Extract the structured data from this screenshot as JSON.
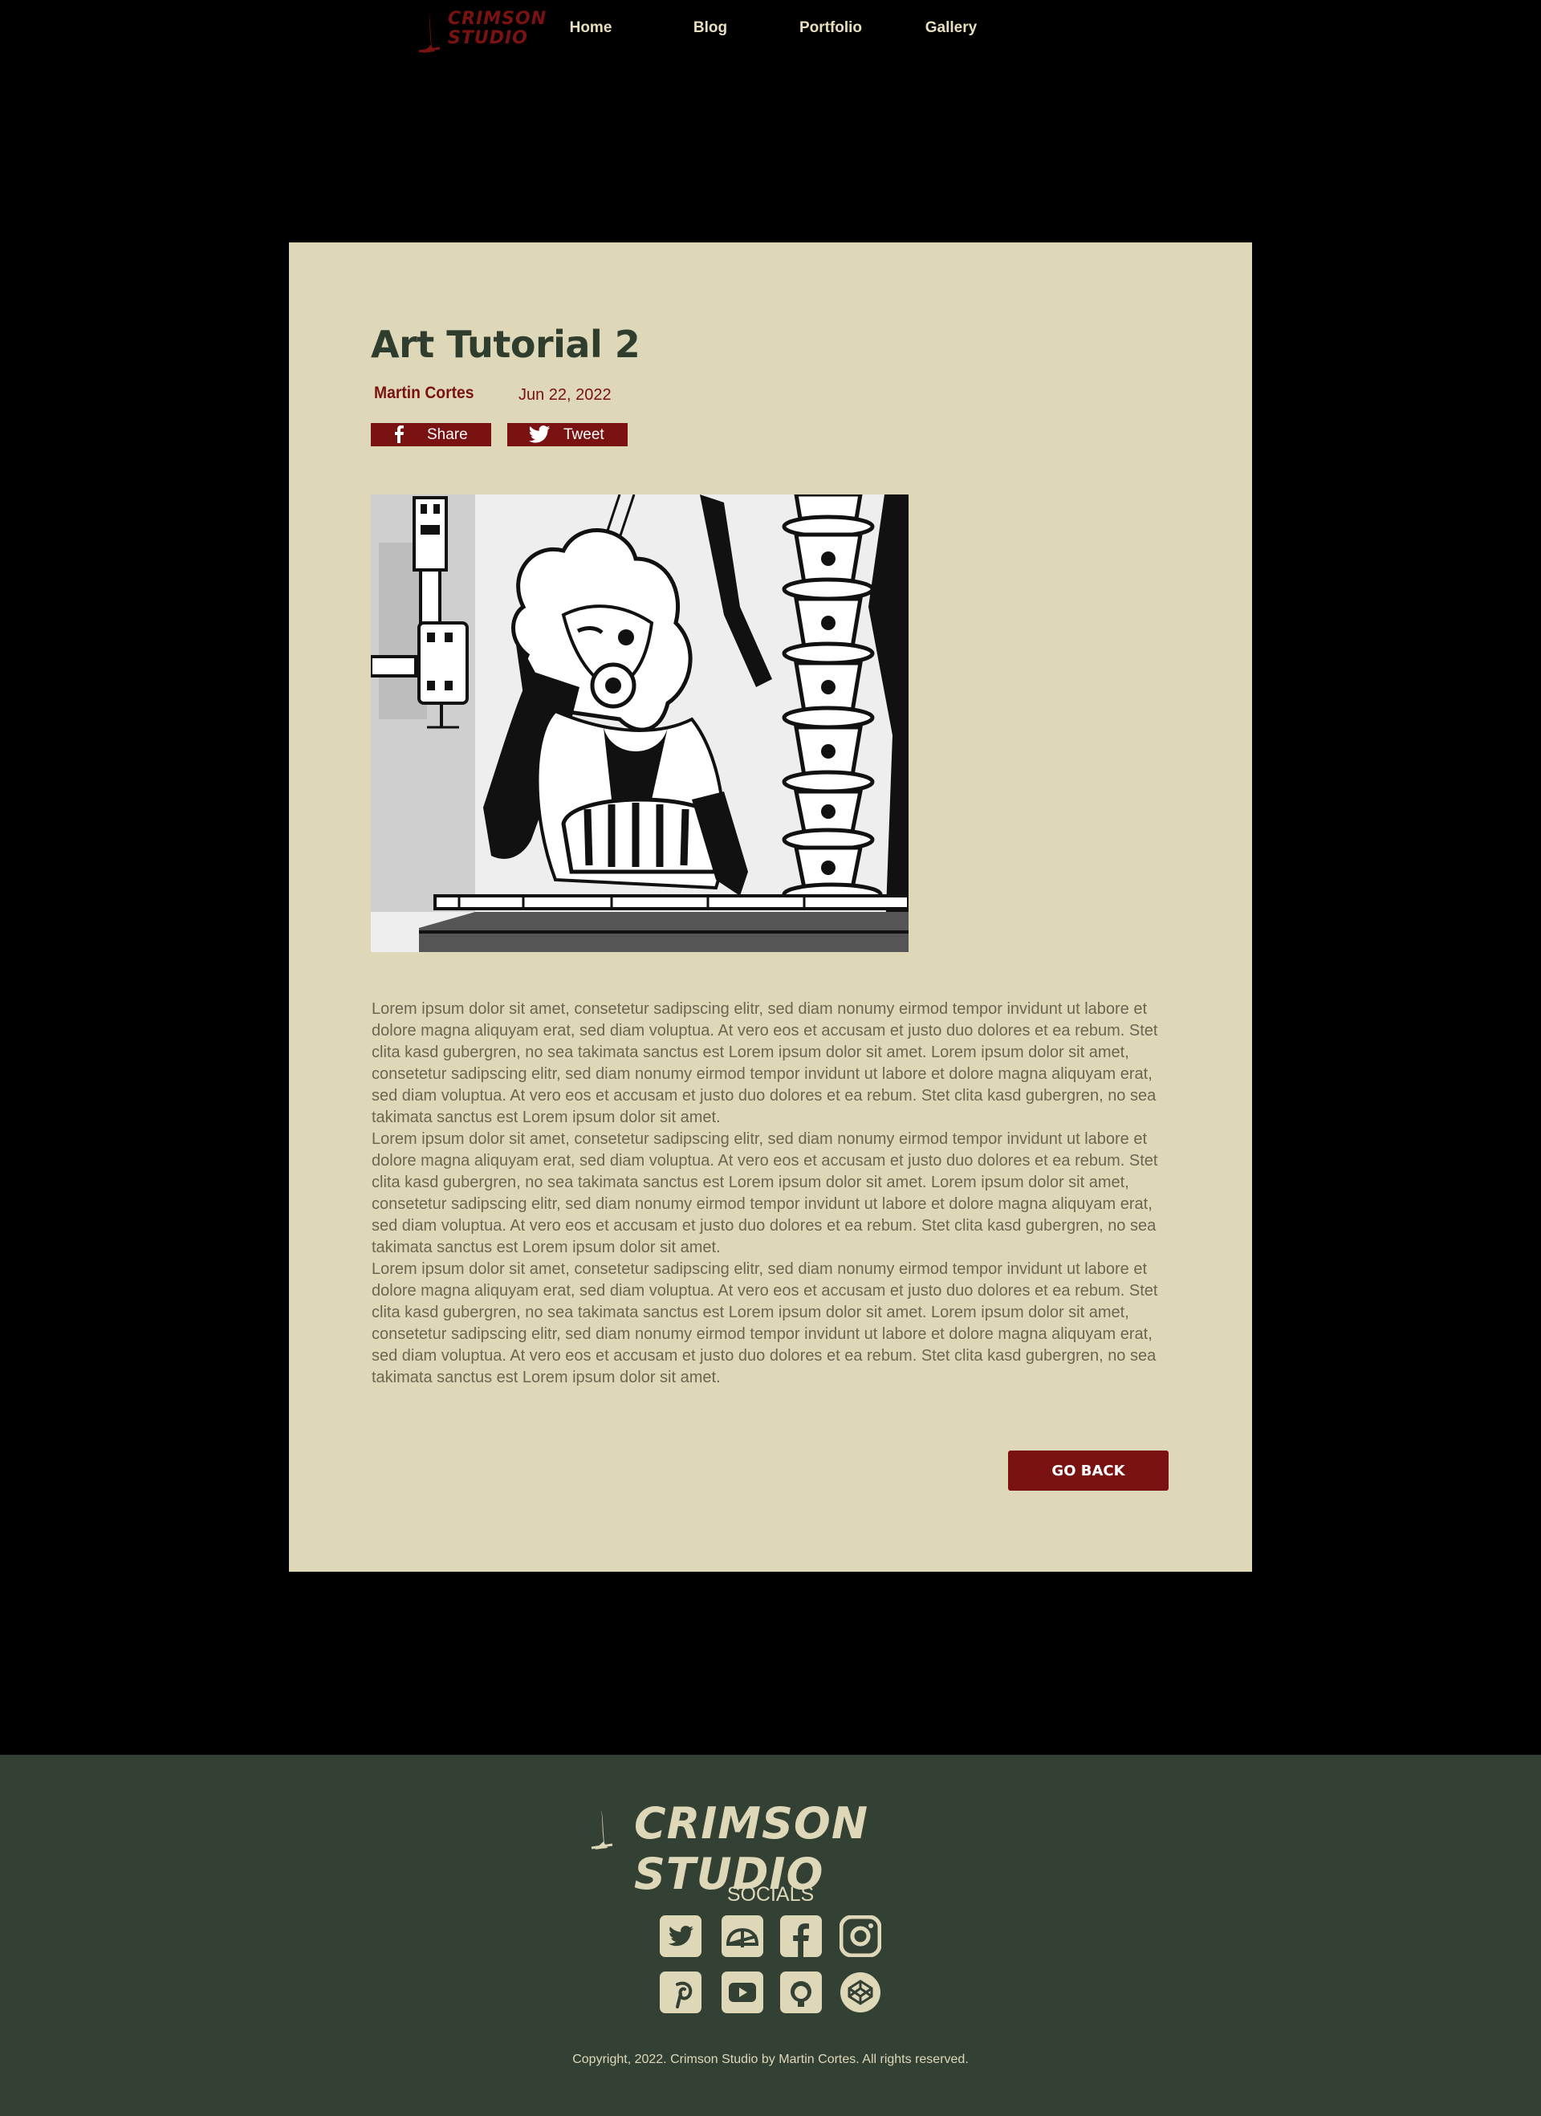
{
  "brand": {
    "line1": "CRIMSON",
    "line2": "STUDIO",
    "footer_name": "CRIMSON STUDIO",
    "accent_color": "#7a1212",
    "card_color": "#ded7b8",
    "footer_color": "#334134"
  },
  "nav": {
    "links": [
      "Home",
      "Blog",
      "Portfolio",
      "Gallery"
    ]
  },
  "post": {
    "title": "Art Tutorial 2",
    "author": "Martin Cortes",
    "date": "Jun 22, 2022",
    "share_label": "Share",
    "tweet_label": "Tweet",
    "image_icon": "manga-illustration",
    "paragraphs": [
      "Lorem ipsum dolor sit amet, consetetur sadipscing elitr, sed diam nonumy eirmod tempor invidunt ut labore et dolore magna aliquyam erat, sed diam voluptua. At vero eos et accusam et justo duo dolores et ea rebum. Stet clita kasd gubergren, no sea takimata sanctus est Lorem ipsum dolor sit amet. Lorem ipsum dolor sit amet, consetetur sadipscing elitr, sed diam nonumy eirmod tempor invidunt ut labore et dolore magna aliquyam erat, sed diam voluptua. At vero eos et accusam et justo duo dolores et ea rebum. Stet clita kasd gubergren, no sea takimata sanctus est Lorem ipsum dolor sit amet.",
      "Lorem ipsum dolor sit amet, consetetur sadipscing elitr, sed diam nonumy eirmod tempor invidunt ut labore et dolore magna aliquyam erat, sed diam voluptua. At vero eos et accusam et justo duo dolores et ea rebum. Stet clita kasd gubergren, no sea takimata sanctus est Lorem ipsum dolor sit amet. Lorem ipsum dolor sit amet, consetetur sadipscing elitr, sed diam nonumy eirmod tempor invidunt ut labore et dolore magna aliquyam erat, sed diam voluptua. At vero eos et accusam et justo duo dolores et ea rebum. Stet clita kasd gubergren, no sea takimata sanctus est Lorem ipsum dolor sit amet.",
      "Lorem ipsum dolor sit amet, consetetur sadipscing elitr, sed diam nonumy eirmod tempor invidunt ut labore et dolore magna aliquyam erat, sed diam voluptua. At vero eos et accusam et justo duo dolores et ea rebum. Stet clita kasd gubergren, no sea takimata sanctus est Lorem ipsum dolor sit amet. Lorem ipsum dolor sit amet, consetetur sadipscing elitr, sed diam nonumy eirmod tempor invidunt ut labore et dolore magna aliquyam erat, sed diam voluptua. At vero eos et accusam et justo duo dolores et ea rebum. Stet clita kasd gubergren, no sea takimata sanctus est Lorem ipsum dolor sit amet."
    ],
    "go_back_label": "GO BACK"
  },
  "footer": {
    "socials_title": "SOCIALS",
    "social_icons": [
      "twitter-icon",
      "deviantart-icon",
      "facebook-icon",
      "instagram-icon",
      "pinterest-icon",
      "youtube-icon",
      "github-icon",
      "codepen-icon"
    ],
    "copyright": "Copyright, 2022. Crimson Studio by Martin Cortes. All rights reserved."
  }
}
